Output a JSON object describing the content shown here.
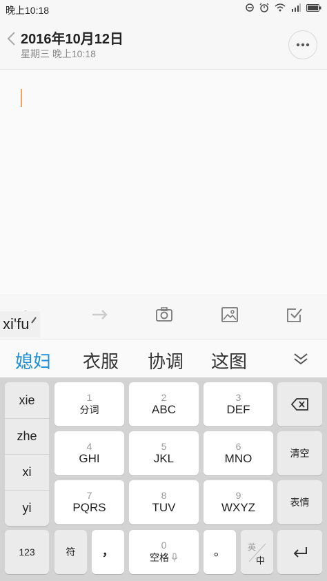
{
  "status": {
    "time": "晚上10:18"
  },
  "header": {
    "title": "2016年10月12日",
    "subtitle": "星期三 晚上10:18"
  },
  "composition": "xi'fu",
  "candidates": [
    "媳妇",
    "衣服",
    "协调",
    "这图"
  ],
  "pinyin": [
    "xie",
    "zhe",
    "xi",
    "yi"
  ],
  "keys": {
    "k1": {
      "num": "1",
      "label": "分词"
    },
    "k2": {
      "num": "2",
      "label": "ABC"
    },
    "k3": {
      "num": "3",
      "label": "DEF"
    },
    "k4": {
      "num": "4",
      "label": "GHI"
    },
    "k5": {
      "num": "5",
      "label": "JKL"
    },
    "k6": {
      "num": "6",
      "label": "MNO"
    },
    "k7": {
      "num": "7",
      "label": "PQRS"
    },
    "k8": {
      "num": "8",
      "label": "TUV"
    },
    "k9": {
      "num": "9",
      "label": "WXYZ"
    },
    "k0": {
      "num": "0",
      "label": "空格"
    },
    "clear": "清空",
    "emoji": "表情",
    "num_mode": "123",
    "symbol": "符",
    "comma": "，",
    "period": "。",
    "lang_top": "英",
    "lang_bottom": "中"
  },
  "colors": {
    "accent": "#1c8ed6",
    "cursor": "#f2a25a",
    "keyboard_bg": "#d3d3d3"
  },
  "icons": [
    "back-arrow-icon",
    "more-icon",
    "undo-icon",
    "redo-icon",
    "camera-icon",
    "image-icon",
    "checkbox-icon",
    "collapse-icon",
    "backspace-icon",
    "enter-icon",
    "mic-icon"
  ]
}
